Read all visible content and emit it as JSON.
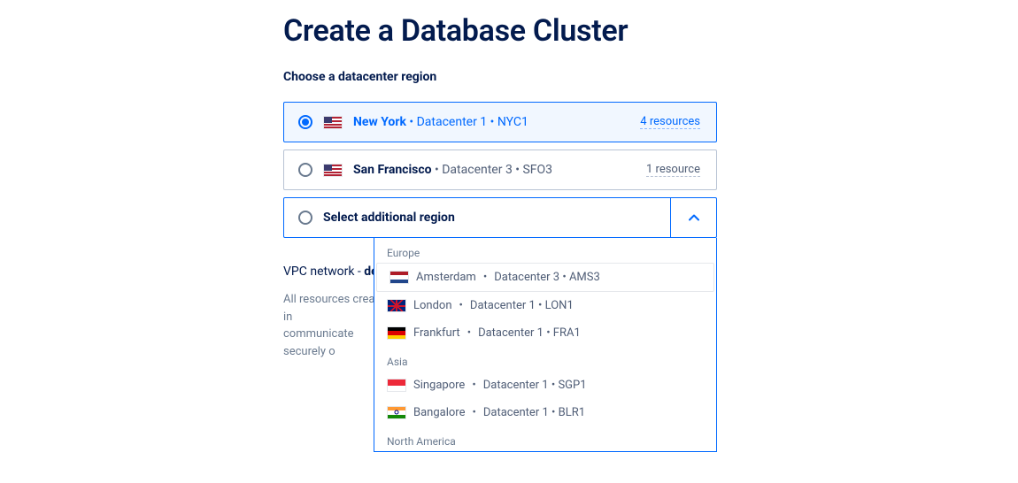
{
  "page_title": "Create a Database Cluster",
  "section_label": "Choose a datacenter region",
  "regions": [
    {
      "name": "New York",
      "detail": " • Datacenter 1 • NYC1",
      "resources": "4 resources"
    },
    {
      "name": "San Francisco",
      "detail": " • Datacenter 3 • SFO3",
      "resources": "1 resource"
    }
  ],
  "select": {
    "label": "Select additional region",
    "groups": [
      {
        "label": "Europe",
        "items": [
          {
            "city": "Amsterdam",
            "detail": "Datacenter 3 • AMS3"
          },
          {
            "city": "London",
            "detail": "Datacenter 1 • LON1"
          },
          {
            "city": "Frankfurt",
            "detail": "Datacenter 1 • FRA1"
          }
        ]
      },
      {
        "label": "Asia",
        "items": [
          {
            "city": "Singapore",
            "detail": "Datacenter 1 • SGP1"
          },
          {
            "city": "Bangalore",
            "detail": "Datacenter 1 • BLR1"
          }
        ]
      },
      {
        "label": "North America",
        "items": []
      }
    ]
  },
  "vpc": {
    "title_prefix": "VPC network - ",
    "title_bold": "defaul",
    "desc_line1": "All resources created in ",
    "desc_line2": "communicate securely o"
  }
}
